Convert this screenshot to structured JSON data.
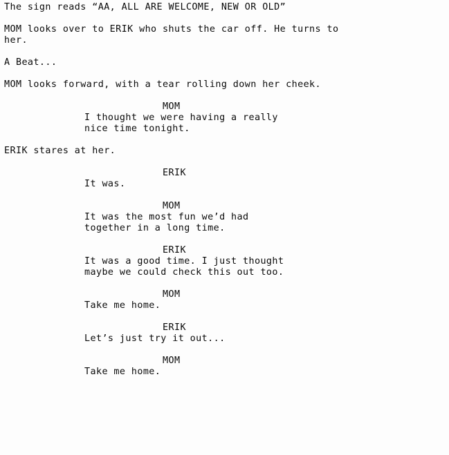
{
  "document": {
    "type": "screenplay-page",
    "text_color": "#0a0a0a",
    "background_color": "#fdfdfd",
    "blocks": [
      {
        "kind": "action",
        "text": "The sign reads “AA, ALL ARE WELCOME, NEW OR OLD”"
      },
      {
        "kind": "action",
        "text": "MOM looks over to ERIK who shuts the car off. He turns to\nher."
      },
      {
        "kind": "action",
        "text": "A Beat..."
      },
      {
        "kind": "action",
        "text": "MOM looks forward, with a tear rolling down her cheek."
      },
      {
        "kind": "dialogue",
        "character": "MOM",
        "text": "I thought we were having a really\nnice time tonight."
      },
      {
        "kind": "action",
        "text": "ERIK stares at her."
      },
      {
        "kind": "dialogue",
        "character": "ERIK",
        "text": "It was."
      },
      {
        "kind": "dialogue",
        "character": "MOM",
        "text": "It was the most fun we’d had\ntogether in a long time."
      },
      {
        "kind": "dialogue",
        "character": "ERIK",
        "text": "It was a good time. I just thought\nmaybe we could check this out too."
      },
      {
        "kind": "dialogue",
        "character": "MOM",
        "text": "Take me home."
      },
      {
        "kind": "dialogue",
        "character": "ERIK",
        "text": "Let’s just try it out..."
      },
      {
        "kind": "dialogue",
        "character": "MOM",
        "text": "Take me home."
      }
    ]
  }
}
